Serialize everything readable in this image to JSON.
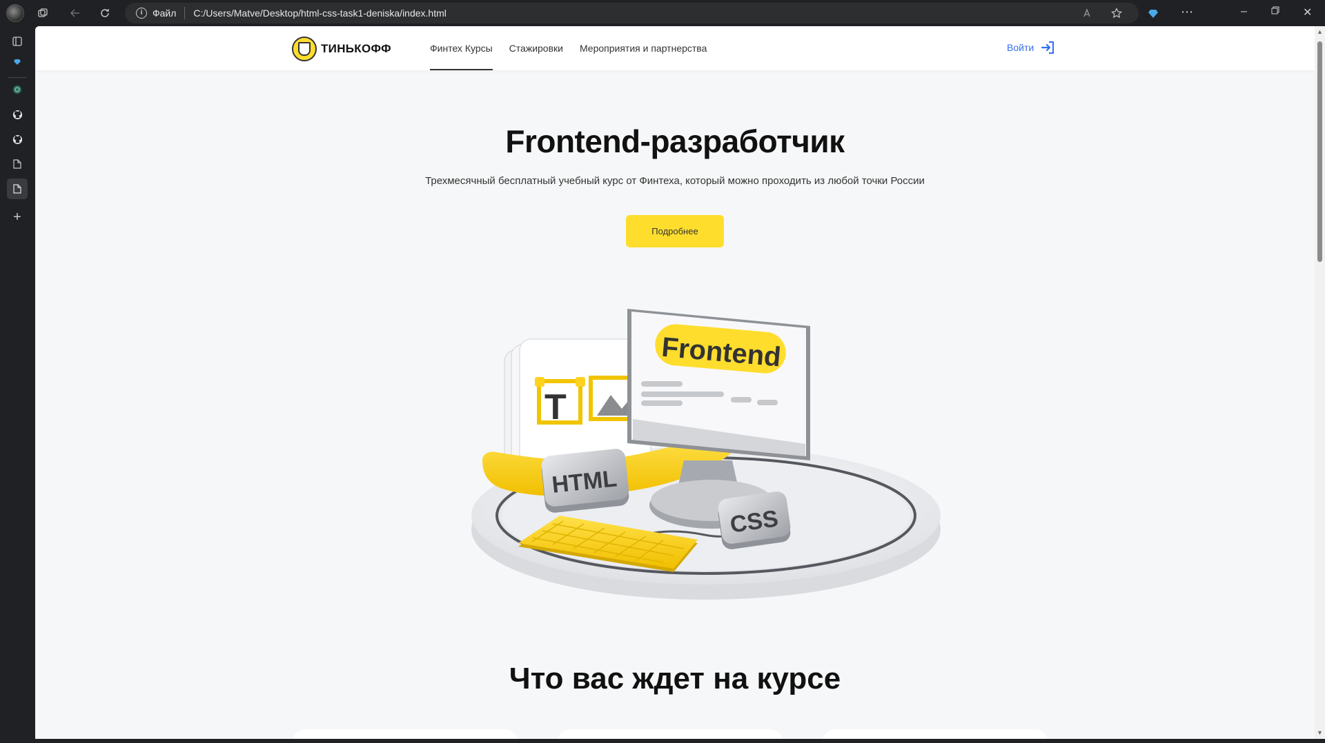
{
  "browser": {
    "address_scheme": "Файл",
    "address_url": "C:/Users/Matve/Desktop/html-css-task1-deniska/index.html"
  },
  "site": {
    "logo_text": "ТИНЬКОФФ",
    "nav": [
      {
        "label": "Финтех Курсы",
        "active": true
      },
      {
        "label": "Стажировки",
        "active": false
      },
      {
        "label": "Мероприятия и партнерства",
        "active": false
      }
    ],
    "login_label": "Войти",
    "accent_color": "#ffdd2d",
    "link_color": "#336fee"
  },
  "hero": {
    "title": "Frontend-разработчик",
    "subtitle": "Трехмесячный бесплатный учебный курс от Финтеха, который можно проходить из любой точки России",
    "button_label": "Подробнее"
  },
  "illustration": {
    "screen_label": "Frontend",
    "html_label": "HTML",
    "css_label": "CSS",
    "text_tool_label": "T"
  },
  "section": {
    "title": "Что вас ждет на курсе"
  }
}
